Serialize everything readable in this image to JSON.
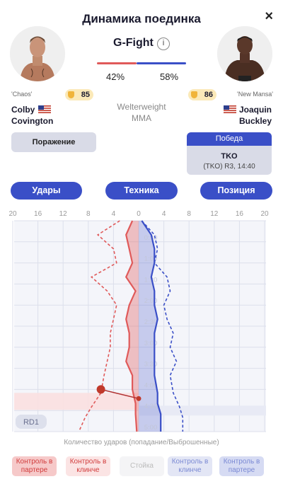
{
  "header": {
    "title": "Динамика поединка",
    "close_glyph": "×"
  },
  "score": {
    "label": "G-Fight",
    "info_glyph": "i",
    "left_pct": "42%",
    "right_pct": "58%",
    "left_fraction": 0.42,
    "right_fraction": 0.58
  },
  "fighter_left": {
    "nickname": "'Chaos'",
    "rating": "85",
    "first_name": "Colby",
    "last_name": "Covington",
    "result_label": "Поражение"
  },
  "fighter_right": {
    "nickname": "'New Mansa'",
    "rating": "86",
    "first_name": "Joaquin",
    "last_name": "Buckley"
  },
  "fight": {
    "weight_class": "Welterweight",
    "discipline": "MMA"
  },
  "win_box": {
    "header": "Победа",
    "result": "TKO",
    "details": "(TKO) R3, 14:40"
  },
  "tabs": [
    "Удары",
    "Техника",
    "Позиция"
  ],
  "chart_data": {
    "type": "line",
    "x_ticks": [
      "20",
      "16",
      "12",
      "8",
      "4",
      "0",
      "4",
      "8",
      "12",
      "16",
      "20"
    ],
    "y_ticks": [
      "0:30",
      "1:00",
      "1:30",
      "2:00",
      "2:30",
      "3:00",
      "3:30",
      "4:00",
      "4:30",
      "5:00"
    ],
    "round_label": "RD1",
    "xlabel": "Количество ударов (попадание/Выброшенные)",
    "colors": {
      "red": "#e05a5a",
      "blue": "#3a4fc7"
    },
    "highlight_time": "4:15",
    "marker_value_left": -6,
    "series": [
      {
        "name": "Colby Covington",
        "side": "left",
        "style": "solid",
        "points": [
          [
            -1,
            0
          ],
          [
            -2,
            20
          ],
          [
            -1.5,
            40
          ],
          [
            -1,
            60
          ],
          [
            -2,
            80
          ],
          [
            -0.5,
            100
          ],
          [
            -1.5,
            120
          ],
          [
            -2,
            140
          ],
          [
            -1.5,
            160
          ],
          [
            -1.5,
            180
          ],
          [
            -2,
            200
          ],
          [
            -1,
            220
          ],
          [
            -1,
            240
          ],
          [
            -0.5,
            260
          ],
          [
            -0.5,
            275
          ],
          [
            -0.3,
            300
          ]
        ]
      },
      {
        "name": "Colby Covington",
        "side": "left",
        "style": "dashed",
        "points": [
          [
            -3,
            0
          ],
          [
            -6.5,
            20
          ],
          [
            -4,
            40
          ],
          [
            -3.5,
            60
          ],
          [
            -7.5,
            80
          ],
          [
            -5,
            100
          ],
          [
            -3.5,
            120
          ],
          [
            -4,
            140
          ],
          [
            -4.5,
            160
          ],
          [
            -4.5,
            180
          ],
          [
            -5,
            200
          ],
          [
            -5.5,
            220
          ],
          [
            -6,
            245
          ],
          [
            -7.5,
            265
          ],
          [
            -8.5,
            280
          ],
          [
            -9.5,
            300
          ]
        ]
      },
      {
        "name": "Joaquin Buckley",
        "side": "right",
        "style": "solid",
        "points": [
          [
            0.5,
            0
          ],
          [
            2,
            20
          ],
          [
            2.5,
            40
          ],
          [
            2.5,
            60
          ],
          [
            2,
            80
          ],
          [
            2.5,
            100
          ],
          [
            2.5,
            120
          ],
          [
            3,
            140
          ],
          [
            2.5,
            160
          ],
          [
            2.5,
            180
          ],
          [
            2.5,
            200
          ],
          [
            2.5,
            220
          ],
          [
            3,
            245
          ],
          [
            3,
            260
          ],
          [
            3.5,
            275
          ],
          [
            3.5,
            300
          ]
        ]
      },
      {
        "name": "Joaquin Buckley",
        "side": "right",
        "style": "dashed",
        "points": [
          [
            0.5,
            0
          ],
          [
            2.5,
            20
          ],
          [
            3,
            40
          ],
          [
            2.5,
            60
          ],
          [
            4.5,
            80
          ],
          [
            5,
            100
          ],
          [
            4,
            120
          ],
          [
            4.5,
            140
          ],
          [
            5.5,
            160
          ],
          [
            5,
            180
          ],
          [
            6,
            200
          ],
          [
            5,
            220
          ],
          [
            5.5,
            245
          ],
          [
            6.5,
            265
          ],
          [
            7,
            280
          ],
          [
            7,
            300
          ]
        ]
      }
    ]
  },
  "legend": [
    {
      "line1": "Контроль в",
      "line2": "партере"
    },
    {
      "line1": "Контроль в",
      "line2": "клинче"
    },
    {
      "line1": "Стойка",
      "line2": ""
    },
    {
      "line1": "Контроль в",
      "line2": "клинче"
    },
    {
      "line1": "Контроль в",
      "line2": "партере"
    }
  ]
}
